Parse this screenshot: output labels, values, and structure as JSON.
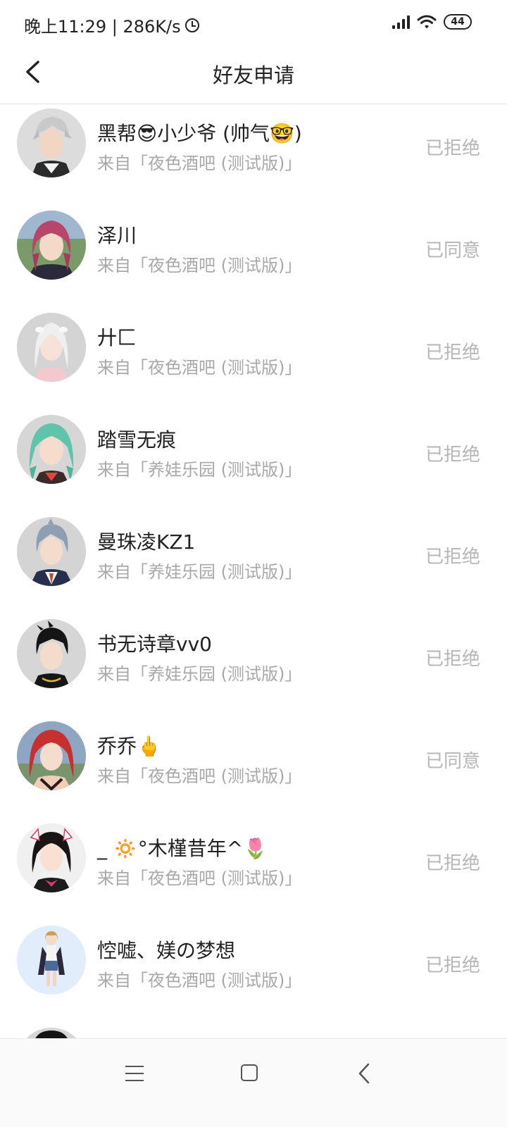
{
  "status_bar": {
    "time_speed": "晚上11:29 | 286K/s",
    "battery": "44"
  },
  "header": {
    "title": "好友申请"
  },
  "requests": [
    {
      "name": "黑帮😎小少爷 (帅气🤓)",
      "source": "来自「夜色酒吧 (测试版)」",
      "status": "已拒绝",
      "avatar": "silver-hair-avatar"
    },
    {
      "name": "泽川",
      "source": "来自「夜色酒吧 (测试版)」",
      "status": "已同意",
      "avatar": "red-hair-avatar"
    },
    {
      "name": "廾匚",
      "source": "来自「夜色酒吧 (测试版)」",
      "status": "已拒绝",
      "avatar": "white-hair-avatar"
    },
    {
      "name": "踏雪无痕",
      "source": "来自「养娃乐园 (测试版)」",
      "status": "已拒绝",
      "avatar": "teal-hair-avatar"
    },
    {
      "name": "曼珠凌KZ1",
      "source": "来自「养娃乐园 (测试版)」",
      "status": "已拒绝",
      "avatar": "blue-gray-hair-avatar"
    },
    {
      "name": "书无诗章vv0",
      "source": "来自「养娃乐园 (测试版)」",
      "status": "已拒绝",
      "avatar": "black-hair-avatar"
    },
    {
      "name": "乔乔🖕",
      "source": "来自「夜色酒吧 (测试版)」",
      "status": "已同意",
      "avatar": "crimson-hair-avatar"
    },
    {
      "name": "_ 🔅°木槿昔年^🌷",
      "source": "来自「夜色酒吧 (测试版)」",
      "status": "已拒绝",
      "avatar": "maid-avatar"
    },
    {
      "name": "悾嘘、媄の梦想",
      "source": "来自「夜色酒吧 (测试版)」",
      "status": "已拒绝",
      "avatar": "full-body-avatar"
    }
  ],
  "colors": {
    "name": "#222222",
    "source": "#a8a8a8",
    "status": "#b6b6b6",
    "divider": "#e6e6e6"
  }
}
